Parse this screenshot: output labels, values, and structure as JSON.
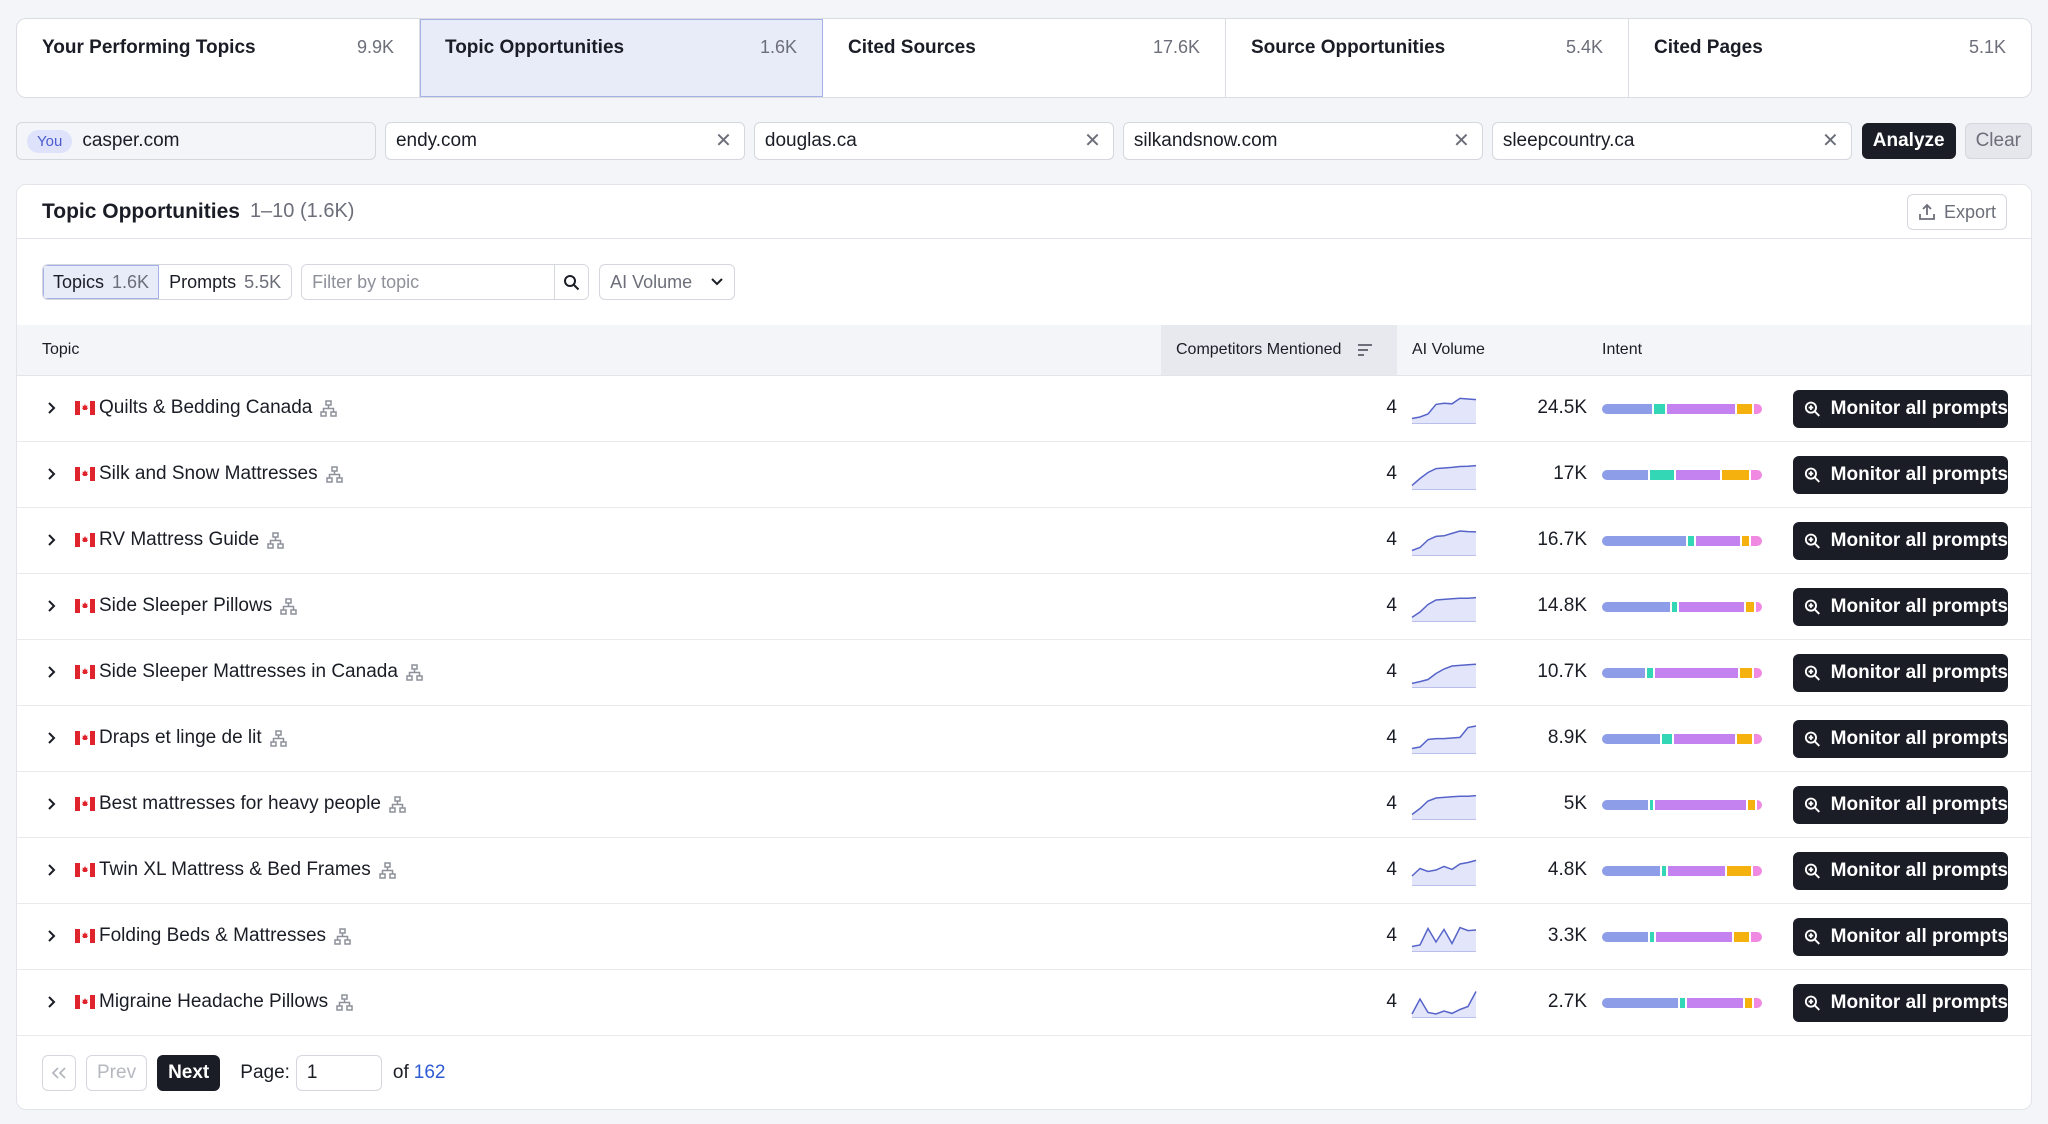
{
  "tabs": [
    {
      "label": "Your Performing Topics",
      "count": "9.9K"
    },
    {
      "label": "Topic Opportunities",
      "count": "1.6K"
    },
    {
      "label": "Cited Sources",
      "count": "17.6K"
    },
    {
      "label": "Source Opportunities",
      "count": "5.4K"
    },
    {
      "label": "Cited Pages",
      "count": "5.1K"
    }
  ],
  "active_tab": "Topic Opportunities",
  "domains": {
    "you_badge": "You",
    "you": "casper.com",
    "competitors": [
      "endy.com",
      "douglas.ca",
      "silkandsnow.com",
      "sleepcountry.ca"
    ],
    "analyze_label": "Analyze",
    "clear_label": "Clear"
  },
  "panel": {
    "title": "Topic Opportunities",
    "range": "1–10 (1.6K)",
    "export_label": "Export"
  },
  "filters": {
    "topics_label": "Topics",
    "topics_count": "1.6K",
    "prompts_label": "Prompts",
    "prompts_count": "5.5K",
    "search_placeholder": "Filter by topic",
    "volume_dropdown": "AI Volume"
  },
  "columns": {
    "topic": "Topic",
    "competitors": "Competitors Mentioned",
    "volume": "AI Volume",
    "intent": "Intent"
  },
  "intent_colors": [
    "#8d9de8",
    "#33d6b5",
    "#c481f0",
    "#f5b20f",
    "#f089e2"
  ],
  "accent_color": "#1b1d26",
  "flag_icon": "canada-flag-icon",
  "rows": [
    {
      "topic": "Quilts & Bedding Canada",
      "competitors": "4",
      "volume": "24.5K",
      "trend": [
        0.15,
        0.2,
        0.3,
        0.62,
        0.66,
        0.64,
        0.82,
        0.8,
        0.78
      ],
      "intent": [
        0.33,
        0.07,
        0.45,
        0.1,
        0.05
      ]
    },
    {
      "topic": "Silk and Snow Mattresses",
      "competitors": "4",
      "volume": "17K",
      "trend": [
        0.12,
        0.35,
        0.55,
        0.68,
        0.7,
        0.72,
        0.75,
        0.76,
        0.78
      ],
      "intent": [
        0.3,
        0.16,
        0.29,
        0.18,
        0.07
      ]
    },
    {
      "topic": "RV Mattress Guide",
      "competitors": "4",
      "volume": "16.7K",
      "trend": [
        0.15,
        0.25,
        0.5,
        0.62,
        0.64,
        0.72,
        0.8,
        0.78,
        0.77
      ],
      "intent": [
        0.55,
        0.04,
        0.29,
        0.05,
        0.07
      ]
    },
    {
      "topic": "Side Sleeper Pillows",
      "competitors": "4",
      "volume": "14.8K",
      "trend": [
        0.12,
        0.3,
        0.55,
        0.7,
        0.72,
        0.74,
        0.76,
        0.76,
        0.78
      ],
      "intent": [
        0.45,
        0.03,
        0.43,
        0.05,
        0.04
      ]
    },
    {
      "topic": "Side Sleeper Mattresses in Canada",
      "competitors": "4",
      "volume": "10.7K",
      "trend": [
        0.12,
        0.18,
        0.25,
        0.45,
        0.6,
        0.7,
        0.72,
        0.74,
        0.76
      ],
      "intent": [
        0.28,
        0.04,
        0.55,
        0.08,
        0.05
      ]
    },
    {
      "topic": "Draps et linge de lit",
      "competitors": "4",
      "volume": "8.9K",
      "trend": [
        0.15,
        0.2,
        0.45,
        0.48,
        0.48,
        0.5,
        0.52,
        0.85,
        0.9
      ],
      "intent": [
        0.38,
        0.07,
        0.4,
        0.1,
        0.05
      ]
    },
    {
      "topic": "Best mattresses for heavy people",
      "competitors": "4",
      "volume": "5K",
      "trend": [
        0.15,
        0.35,
        0.6,
        0.7,
        0.72,
        0.74,
        0.76,
        0.76,
        0.78
      ],
      "intent": [
        0.3,
        0.02,
        0.6,
        0.05,
        0.03
      ]
    },
    {
      "topic": "Twin XL Mattress & Bed Frames",
      "competitors": "4",
      "volume": "4.8K",
      "trend": [
        0.3,
        0.55,
        0.45,
        0.5,
        0.62,
        0.52,
        0.7,
        0.75,
        0.82
      ],
      "intent": [
        0.38,
        0.03,
        0.37,
        0.16,
        0.06
      ]
    },
    {
      "topic": "Folding Beds & Mattresses",
      "competitors": "4",
      "volume": "3.3K",
      "trend": [
        0.15,
        0.2,
        0.75,
        0.3,
        0.72,
        0.25,
        0.78,
        0.68,
        0.7
      ],
      "intent": [
        0.3,
        0.03,
        0.5,
        0.1,
        0.07
      ]
    },
    {
      "topic": "Migraine Headache Pillows",
      "competitors": "4",
      "volume": "2.7K",
      "trend": [
        0.1,
        0.6,
        0.15,
        0.1,
        0.2,
        0.12,
        0.25,
        0.35,
        0.85
      ],
      "intent": [
        0.5,
        0.03,
        0.37,
        0.05,
        0.05
      ]
    }
  ],
  "monitor_label": "Monitor all prompts",
  "pagination": {
    "prev_label": "Prev",
    "next_label": "Next",
    "page_label": "Page:",
    "page_value": "1",
    "of_label": "of",
    "total_pages": "162"
  }
}
